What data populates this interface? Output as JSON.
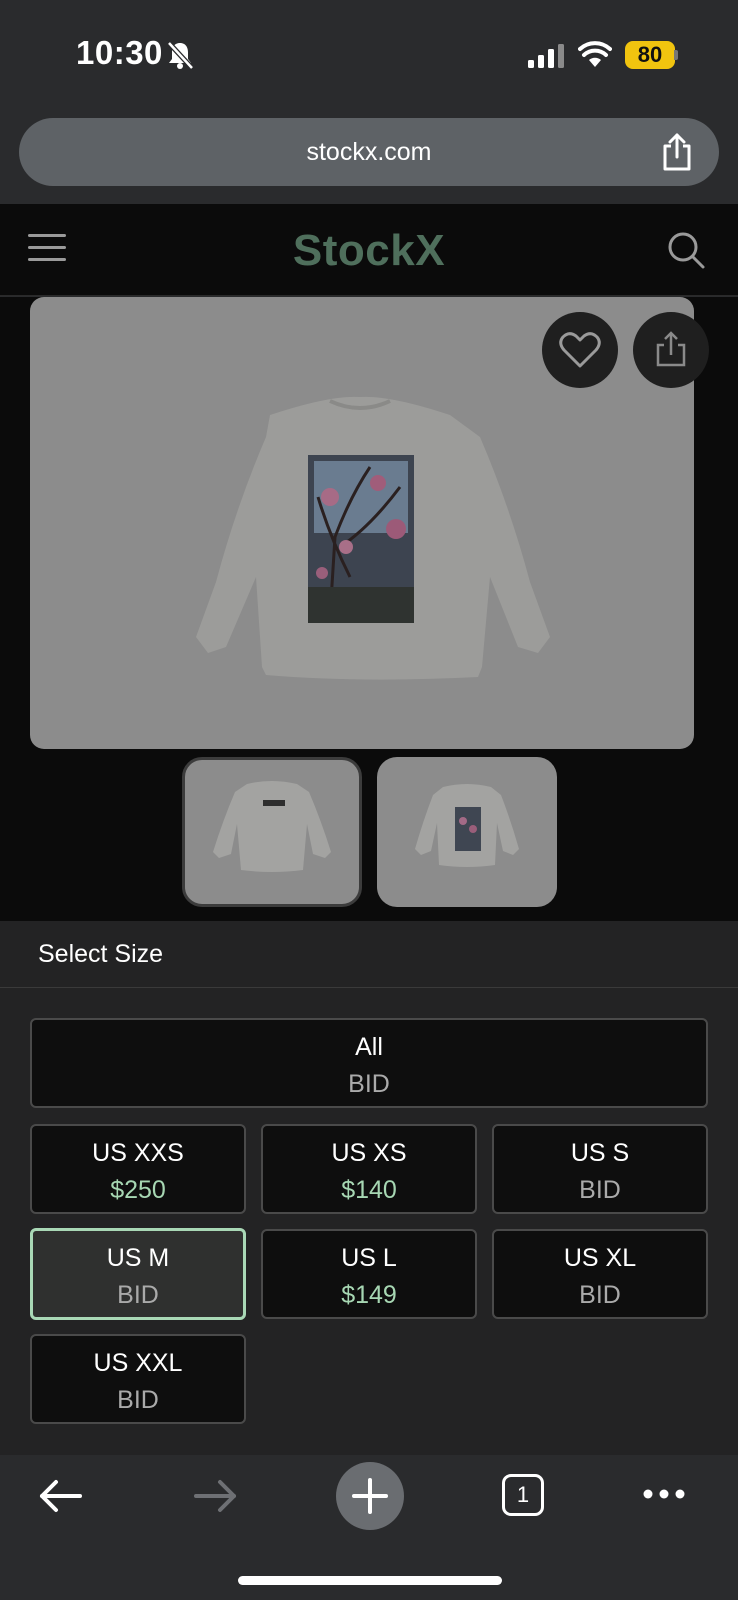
{
  "status_bar": {
    "time": "10:30",
    "battery": "80",
    "icons": [
      "bell-slash-icon",
      "cellular-signal-icon",
      "wifi-icon",
      "battery-icon"
    ]
  },
  "browser": {
    "url": "stockx.com",
    "tabs_count": "1"
  },
  "site": {
    "logo": "StockX",
    "accent_color": "#4f6f5c"
  },
  "product": {
    "images": [
      "long-sleeve-tee-back-photo",
      "long-sleeve-tee-front-thumb",
      "long-sleeve-tee-back-thumb"
    ]
  },
  "size_panel": {
    "title": "Select Size",
    "all": {
      "label": "All",
      "value": "BID"
    },
    "sizes": [
      {
        "label": "US XXS",
        "value": "$250",
        "price": true
      },
      {
        "label": "US XS",
        "value": "$140",
        "price": true
      },
      {
        "label": "US S",
        "value": "BID",
        "price": false
      },
      {
        "label": "US M",
        "value": "BID",
        "price": false,
        "selected": true
      },
      {
        "label": "US L",
        "value": "$149",
        "price": true
      },
      {
        "label": "US XL",
        "value": "BID",
        "price": false
      },
      {
        "label": "US XXL",
        "value": "BID",
        "price": false
      }
    ],
    "selected_color": "#a9d8b6",
    "price_color": "#a7d7b3"
  }
}
